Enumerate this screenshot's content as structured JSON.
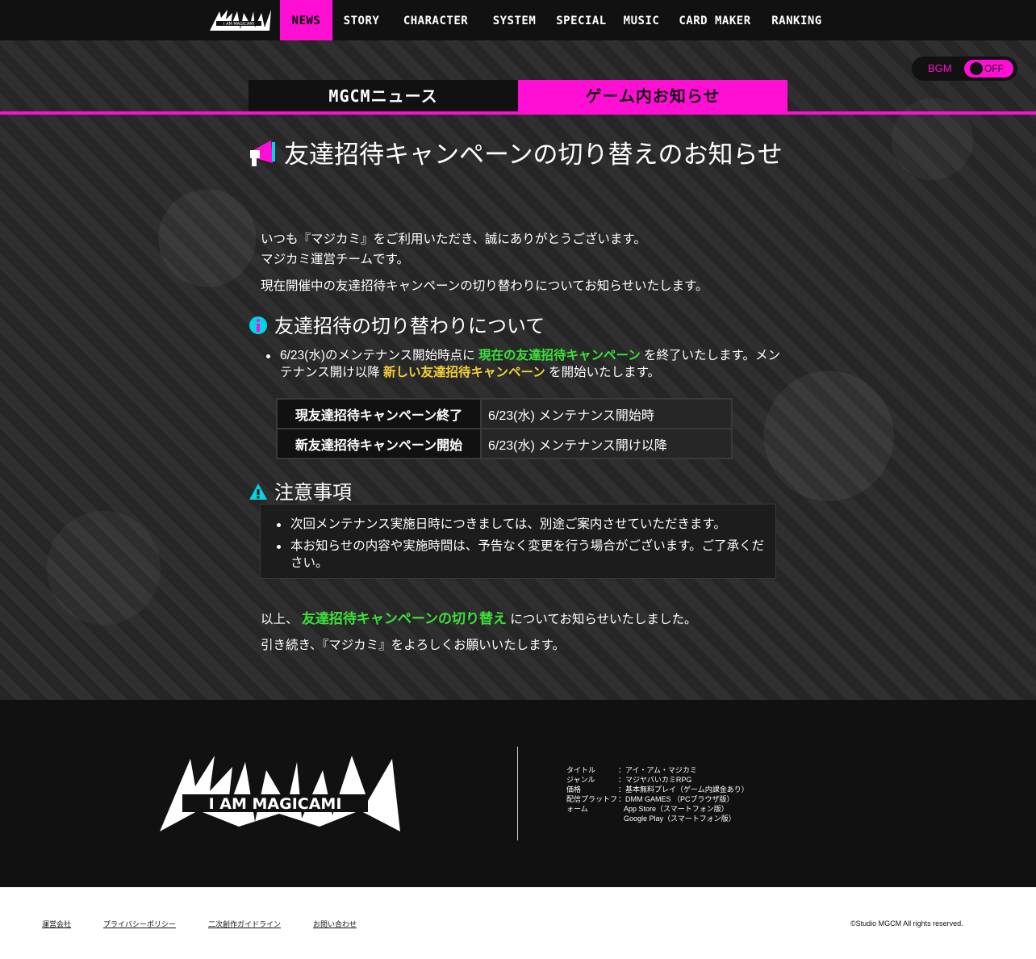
{
  "nav": {
    "logo_text": "I AM MAGICAMI",
    "items": [
      "NEWS",
      "STORY",
      "CHARACTER",
      "SYSTEM",
      "SPECIAL",
      "MUSIC",
      "CARD MAKER",
      "RANKING"
    ]
  },
  "bgm": {
    "label": "BGM",
    "state": "OFF"
  },
  "tabs": {
    "news": "MGCMニュース",
    "game": "ゲーム内お知らせ"
  },
  "article": {
    "title": "友達招待キャンペーンの切り替えのお知らせ",
    "greeting1": "いつも『マジカミ』をご利用いただき、誠にありがとうございます。",
    "greeting2": "マジカミ運営チームです。",
    "intro": "現在開催中の友達招待キャンペーンの切り替わりについてお知らせいたします。",
    "section1_heading": "友達招待の切り替わりについて",
    "bullet_a": "6/23(水)のメンテナンス開始時点に",
    "bullet_current": "現在の友達招待キャンペーン",
    "bullet_b": "を終了いたします。メンテナンス開け以降",
    "bullet_new": "新しい友達招待キャンペーン",
    "bullet_c": "を開始いたします。",
    "table": [
      {
        "label": "現友達招待キャンペーン終了",
        "value": "6/23(水) メンテナンス開始時"
      },
      {
        "label": "新友達招待キャンペーン開始",
        "value": "6/23(水) メンテナンス開け以降"
      }
    ],
    "section2_heading": "注意事項",
    "notes": [
      "次回メンテナンス実施日時につきましては、別途ご案内させていただきます。",
      "本お知らせの内容や実施時間は、予告なく変更を行う場合がございます。ご了承ください。"
    ],
    "closing_a": "以上、",
    "closing_green": "友達招待キャンペーンの切り替え",
    "closing_b": "についてお知らせいたしました。",
    "closing2": "引き続き、『マジカミ』をよろしくお願いいたします。"
  },
  "footer": {
    "logo_text": "I AM MAGICAMI",
    "info": [
      {
        "key": "タイトル",
        "value": "：アイ・アム・マジカミ"
      },
      {
        "key": "ジャンル",
        "value": "：マジヤバいカミRPG"
      },
      {
        "key": "価格",
        "value": "：基本無料プレイ（ゲーム内課金あり）"
      },
      {
        "key": "配信プラットフ",
        "value": "：DMM GAMES （PCブラウザ版）"
      },
      {
        "key": "ォーム",
        "value": "App Store（スマートフォン版）"
      },
      {
        "key": "",
        "value": "Google Play（スマートフォン版）"
      }
    ],
    "links": [
      "運営会社",
      "プライバシーポリシー",
      "二次創作ガイドライン",
      "お問い合わせ"
    ],
    "copyright": "©Studio MGCM All rights reserved."
  }
}
